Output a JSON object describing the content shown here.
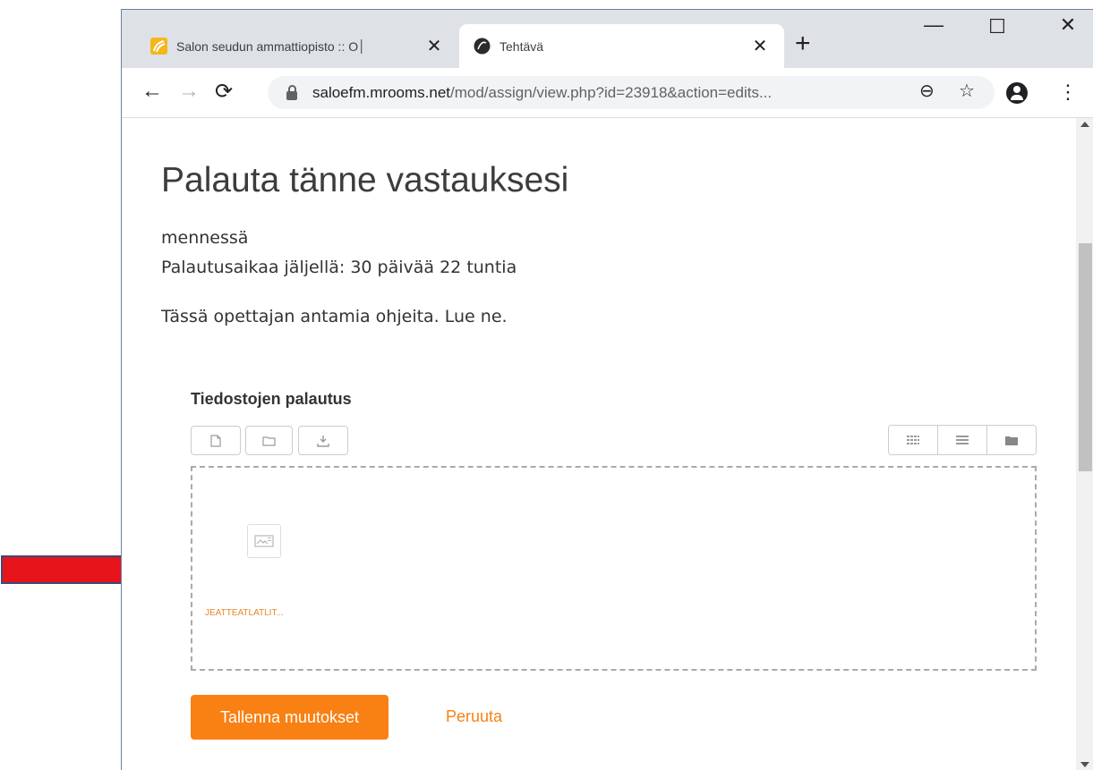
{
  "browser": {
    "tabs": [
      {
        "title": "Salon seudun ammattiopisto :: O│",
        "active": false,
        "favicon": "saloon-logo-icon"
      },
      {
        "title": "Tehtävä",
        "active": true,
        "favicon": "site-logo-icon"
      }
    ],
    "url_host": "saloefm.mrooms.net",
    "url_path": "/mod/assign/view.php?id=23918&action=edits..."
  },
  "page": {
    "title": "Palauta tänne vastauksesi",
    "due_line": "mennessä",
    "time_remaining": "Palautusaikaa jäljellä: 30 päivää 22 tuntia",
    "instructions": "Tässä opettajan antamia ohjeita. Lue ne."
  },
  "filepicker": {
    "label": "Tiedostojen palautus",
    "file_name": "JEATTEATLATLIT..."
  },
  "actions": {
    "save_label": "Tallenna muutokset",
    "cancel_label": "Peruuta"
  },
  "colors": {
    "accent": "#f98012",
    "arrow": "#e8141b"
  }
}
